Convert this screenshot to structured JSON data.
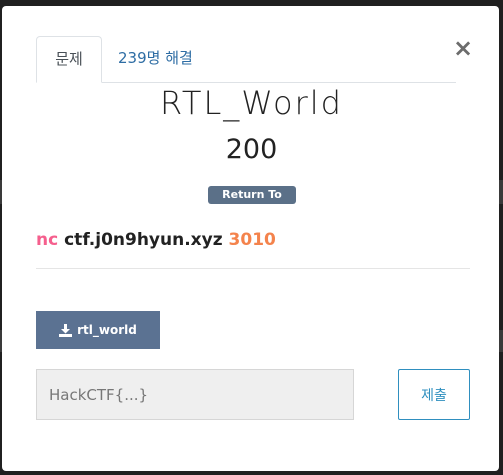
{
  "tabs": [
    {
      "label": "문제",
      "active": true
    },
    {
      "label": "239명 해결",
      "active": false
    }
  ],
  "close_symbol": "×",
  "challenge": {
    "title": "RTL_World",
    "points": "200",
    "category_badge": "Return To Libc",
    "connection": {
      "command": "nc",
      "host": "ctf.j0n9hyun.xyz",
      "port": "3010"
    }
  },
  "file": {
    "icon": "download-icon",
    "name": "rtl_world"
  },
  "flag_form": {
    "placeholder": "HackCTF{...}",
    "value": "",
    "submit_label": "제출"
  },
  "colors": {
    "nc": "#f55f8d",
    "port": "#f4834c",
    "badge": "#5b7088",
    "file_button": "#5b7292",
    "submit_border": "#2f8fbf"
  }
}
